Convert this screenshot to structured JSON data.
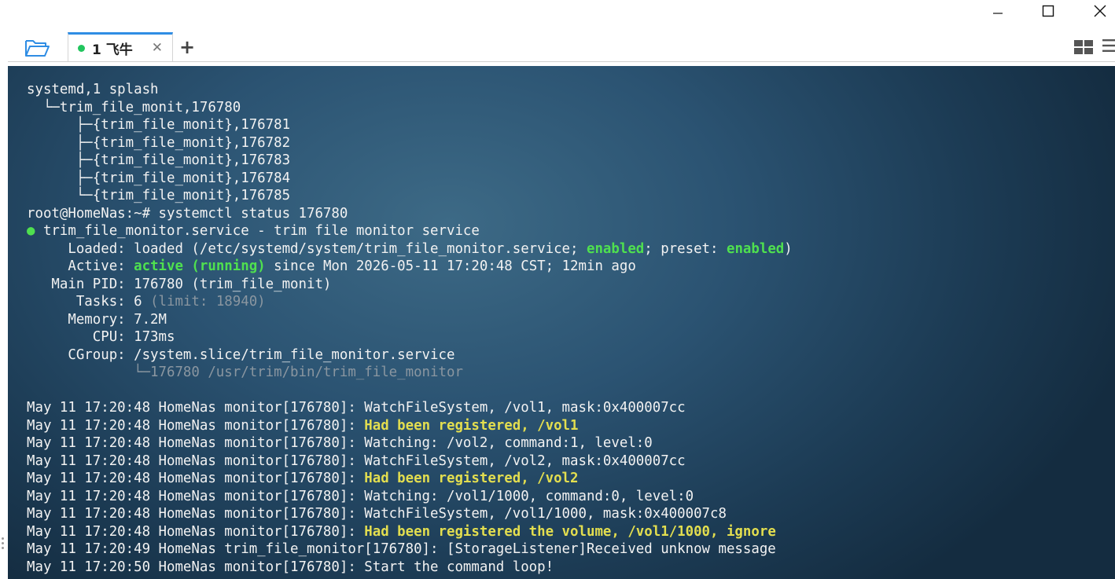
{
  "window": {
    "controls": {
      "minimize": "minimize",
      "maximize": "maximize",
      "close": "close"
    }
  },
  "tabs": [
    {
      "label": "1 飞牛",
      "active": true,
      "status_color": "#22c55e"
    }
  ],
  "colors": {
    "accent": "#2f8de4",
    "green": "#4fe04f",
    "yellow": "#e3de4f",
    "dim": "#8a96a0"
  },
  "terminal": {
    "lines": [
      [
        {
          "t": "systemd,1 splash"
        }
      ],
      [
        {
          "t": "  └─trim_file_monit,176780"
        }
      ],
      [
        {
          "t": "      ├─{trim_file_monit},176781"
        }
      ],
      [
        {
          "t": "      ├─{trim_file_monit},176782"
        }
      ],
      [
        {
          "t": "      ├─{trim_file_monit},176783"
        }
      ],
      [
        {
          "t": "      ├─{trim_file_monit},176784"
        }
      ],
      [
        {
          "t": "      └─{trim_file_monit},176785"
        }
      ],
      [
        {
          "t": "root@HomeNas:~# systemctl status 176780"
        }
      ],
      [
        {
          "t": "●",
          "c": "dot-green"
        },
        {
          "t": " trim_file_monitor.service - trim file monitor service"
        }
      ],
      [
        {
          "t": "     Loaded: loaded (/etc/systemd/system/trim_file_monitor.service; "
        },
        {
          "t": "enabled",
          "c": "c-green"
        },
        {
          "t": "; preset: "
        },
        {
          "t": "enabled",
          "c": "c-green"
        },
        {
          "t": ")"
        }
      ],
      [
        {
          "t": "     Active: "
        },
        {
          "t": "active (running)",
          "c": "c-green"
        },
        {
          "t": " since Mon 2026-05-11 17:20:48 CST; 12min ago"
        }
      ],
      [
        {
          "t": "   Main PID: 176780 (trim_file_monit)"
        }
      ],
      [
        {
          "t": "      Tasks: 6 "
        },
        {
          "t": "(limit: 18940)",
          "c": "c-dim"
        }
      ],
      [
        {
          "t": "     Memory: 7.2M"
        }
      ],
      [
        {
          "t": "        CPU: 173ms"
        }
      ],
      [
        {
          "t": "     CGroup: /system.slice/trim_file_monitor.service"
        }
      ],
      [
        {
          "t": "             └─176780 /usr/trim/bin/trim_file_monitor",
          "c": "c-dim"
        }
      ],
      [
        {
          "t": ""
        }
      ],
      [
        {
          "t": "May 11 17:20:48 HomeNas monitor[176780]: WatchFileSystem, /vol1, mask:0x400007cc"
        }
      ],
      [
        {
          "t": "May 11 17:20:48 HomeNas monitor[176780]: "
        },
        {
          "t": "Had been registered, /vol1",
          "c": "c-yellow"
        }
      ],
      [
        {
          "t": "May 11 17:20:48 HomeNas monitor[176780]: Watching: /vol2, command:1, level:0"
        }
      ],
      [
        {
          "t": "May 11 17:20:48 HomeNas monitor[176780]: WatchFileSystem, /vol2, mask:0x400007cc"
        }
      ],
      [
        {
          "t": "May 11 17:20:48 HomeNas monitor[176780]: "
        },
        {
          "t": "Had been registered, /vol2",
          "c": "c-yellow"
        }
      ],
      [
        {
          "t": "May 11 17:20:48 HomeNas monitor[176780]: Watching: /vol1/1000, command:0, level:0"
        }
      ],
      [
        {
          "t": "May 11 17:20:48 HomeNas monitor[176780]: WatchFileSystem, /vol1/1000, mask:0x400007c8"
        }
      ],
      [
        {
          "t": "May 11 17:20:48 HomeNas monitor[176780]: "
        },
        {
          "t": "Had been registered the volume, /vol1/1000, ignore",
          "c": "c-yellow"
        }
      ],
      [
        {
          "t": "May 11 17:20:49 HomeNas trim_file_monitor[176780]: [StorageListener]Received unknow message"
        }
      ],
      [
        {
          "t": "May 11 17:20:50 HomeNas monitor[176780]: Start the command loop!"
        }
      ]
    ]
  }
}
